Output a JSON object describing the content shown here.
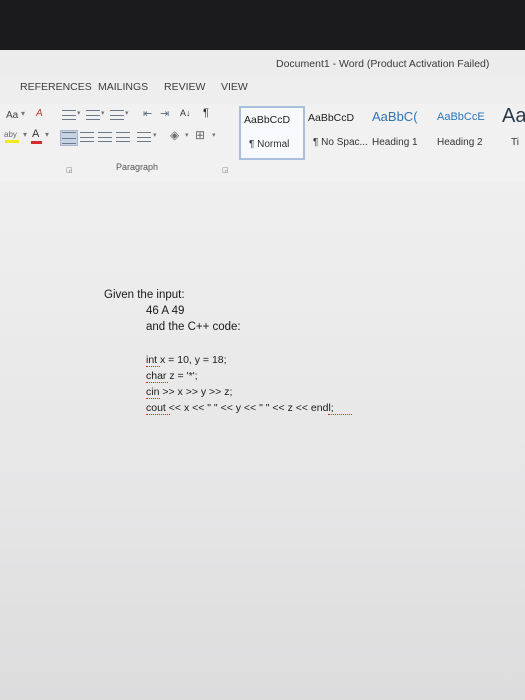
{
  "window": {
    "title": "Document1 - Word (Product Activation Failed)"
  },
  "tabs": [
    {
      "label": "REFERENCES"
    },
    {
      "label": "MAILINGS"
    },
    {
      "label": "REVIEW"
    },
    {
      "label": "VIEW"
    }
  ],
  "ribbon": {
    "font": {
      "change_case_label": "Aa",
      "highlight_label": "aby",
      "font_color_label": "A"
    },
    "paragraph": {
      "group_label": "Paragraph",
      "sort_label": "A↓",
      "show_marks_label": "¶"
    },
    "styles": [
      {
        "sample": "AaBbCcD",
        "name": "¶ Normal",
        "selected": true
      },
      {
        "sample": "AaBbCcD",
        "name": "¶ No Spac..."
      },
      {
        "sample": "AaBbC(",
        "name": "Heading 1"
      },
      {
        "sample": "AaBbCcE",
        "name": "Heading 2"
      },
      {
        "sample": "Aa",
        "name": "Ti"
      }
    ]
  },
  "document": {
    "line1": "Given the input:",
    "line2": "46 A 49",
    "line3": "and the C++ code:",
    "code": [
      "int x = 10, y = 18;",
      "char z = '*';",
      "cin >> x >> y >> z;",
      "cout << x << \" \" << y << \" \" << z << endl;"
    ]
  },
  "colors": {
    "selected_style_border": "#a9c0dc",
    "heading_blue": "#2e74b5",
    "spell_squiggle": "#dd2222"
  }
}
